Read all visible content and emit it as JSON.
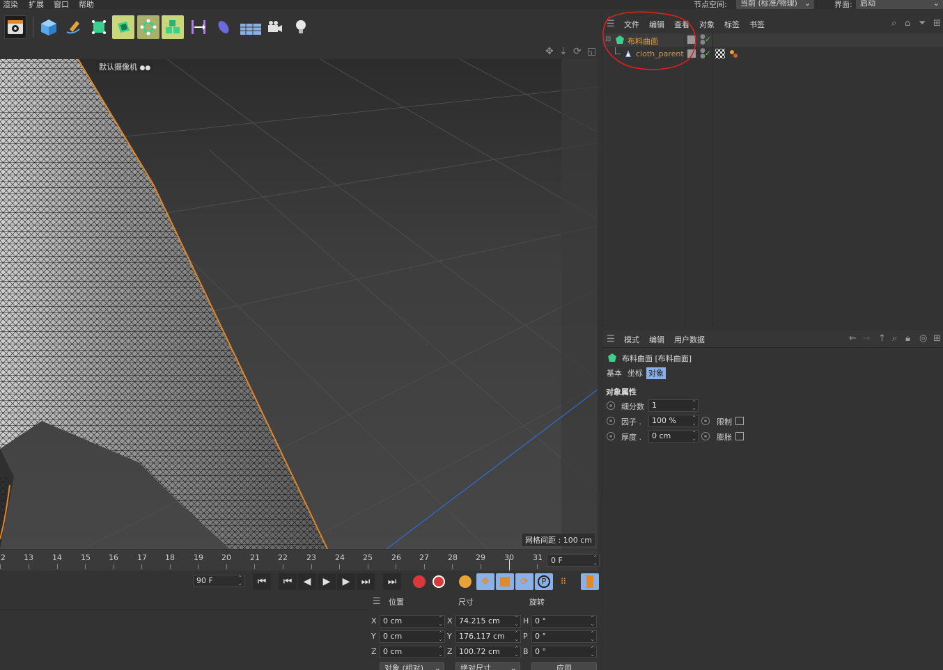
{
  "top_menu": {
    "items": [
      "渲染",
      "扩展",
      "窗口",
      "帮助"
    ],
    "node_space_label": "节点空间:",
    "node_space_value": "当前 (标准/物理)",
    "layout_label": "界面:",
    "layout_value": "启动"
  },
  "viewport": {
    "camera_label": "默认摄像机",
    "grid_spacing": "网格间距 : 100 cm"
  },
  "timeline": {
    "ticks": [
      "2",
      "13",
      "14",
      "15",
      "16",
      "17",
      "18",
      "19",
      "20",
      "21",
      "22",
      "23",
      "24",
      "25",
      "26",
      "27",
      "28",
      "29",
      "30",
      "31"
    ],
    "current_frame": "0 F",
    "end_frame": "90 F"
  },
  "coords": {
    "headers": {
      "position": "位置",
      "size": "尺寸",
      "rotation": "旋转"
    },
    "rows": [
      {
        "axis": "X",
        "pos": "0 cm",
        "size_axis": "X",
        "size": "74.215 cm",
        "rot_axis": "H",
        "rot": "0 °"
      },
      {
        "axis": "Y",
        "pos": "0 cm",
        "size_axis": "Y",
        "size": "176.117 cm",
        "rot_axis": "P",
        "rot": "0 °"
      },
      {
        "axis": "Z",
        "pos": "0 cm",
        "size_axis": "Z",
        "size": "100.72 cm",
        "rot_axis": "B",
        "rot": "0 °"
      }
    ],
    "mode_select": "对象 (相对)",
    "size_select": "绝对尺寸",
    "apply_label": "应用"
  },
  "object_manager": {
    "menu": [
      "文件",
      "编辑",
      "查看",
      "对象",
      "标签",
      "书签"
    ],
    "objects": [
      {
        "name": "布料曲面",
        "color": "#e8a23a"
      },
      {
        "name": "cloth_parent",
        "color": "#c99a5a"
      }
    ]
  },
  "attribute_manager": {
    "menu": [
      "模式",
      "编辑",
      "用户数据"
    ],
    "object_title": "布料曲面 [布料曲面]",
    "tabs": [
      "基本",
      "坐标",
      "对象"
    ],
    "active_tab": "对象",
    "section_title": "对象属性",
    "fields": [
      {
        "label": "细分数",
        "value": "1"
      },
      {
        "label": "因子 .",
        "value": "100 %"
      },
      {
        "label": "厚度 .",
        "value": "0 cm"
      }
    ],
    "checkboxes": [
      {
        "label": "限制"
      },
      {
        "label": "膨胀"
      }
    ]
  },
  "colors": {
    "accent": "#8ab0e8",
    "selection_outline": "#e0862a",
    "annotation": "#e0201f"
  }
}
